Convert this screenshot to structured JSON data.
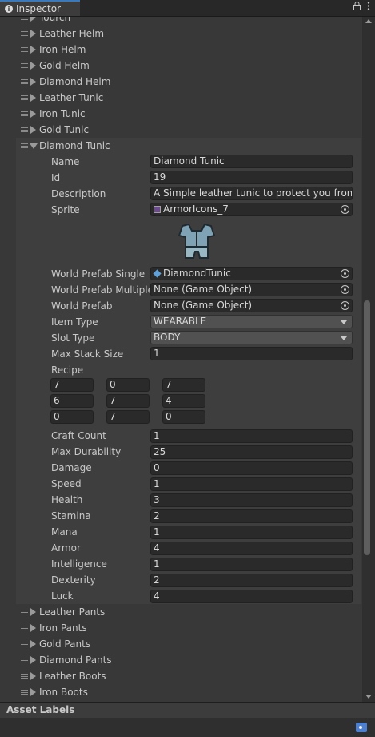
{
  "window": {
    "tab_title": "Inspector",
    "lock_glyph": "🔒",
    "menu_glyph": "⋮"
  },
  "list_top": [
    {
      "label": "Tourch"
    },
    {
      "label": "Leather Helm"
    },
    {
      "label": "Iron Helm"
    },
    {
      "label": "Gold Helm"
    },
    {
      "label": "Diamond Helm"
    },
    {
      "label": "Leather Tunic"
    },
    {
      "label": "Iron Tunic"
    },
    {
      "label": "Gold Tunic"
    }
  ],
  "expanded_item": {
    "label": "Diamond Tunic",
    "labels": {
      "name": "Name",
      "id": "Id",
      "description": "Description",
      "sprite": "Sprite",
      "world_prefab_single": "World Prefab Single",
      "world_prefab_multiple": "World Prefab Multiple",
      "world_prefab": "World Prefab",
      "item_type": "Item Type",
      "slot_type": "Slot Type",
      "max_stack_size": "Max Stack Size",
      "recipe": "Recipe",
      "craft_count": "Craft Count",
      "max_durability": "Max Durability",
      "damage": "Damage",
      "speed": "Speed",
      "health": "Health",
      "stamina": "Stamina",
      "mana": "Mana",
      "armor": "Armor",
      "intelligence": "Intelligence",
      "dexterity": "Dexterity",
      "luck": "Luck"
    },
    "values": {
      "name": "Diamond Tunic",
      "id": "19",
      "description": "A Simple leather tunic to protect you from the",
      "sprite": "ArmorIcons_7",
      "world_prefab_single": "DiamondTunic",
      "world_prefab_multiple": "None (Game Object)",
      "world_prefab": "None (Game Object)",
      "item_type": "WEARABLE",
      "slot_type": "BODY",
      "max_stack_size": "1",
      "craft_count": "1",
      "max_durability": "25",
      "damage": "0",
      "speed": "1",
      "health": "3",
      "stamina": "2",
      "mana": "1",
      "armor": "4",
      "intelligence": "1",
      "dexterity": "2",
      "luck": "4"
    },
    "recipe": [
      [
        "7",
        "0",
        "7"
      ],
      [
        "6",
        "7",
        "4"
      ],
      [
        "0",
        "7",
        "0"
      ]
    ]
  },
  "list_bottom": [
    {
      "label": "Leather Pants"
    },
    {
      "label": "Iron Pants"
    },
    {
      "label": "Gold Pants"
    },
    {
      "label": "Diamond Pants"
    },
    {
      "label": "Leather Boots"
    },
    {
      "label": "Iron Boots"
    }
  ],
  "footer": {
    "asset_labels": "Asset Labels"
  },
  "colors": {
    "accent": "#3a79bb",
    "panel": "#383838",
    "field": "#2a2a2a",
    "armor_fill": "#7fa3b4"
  }
}
